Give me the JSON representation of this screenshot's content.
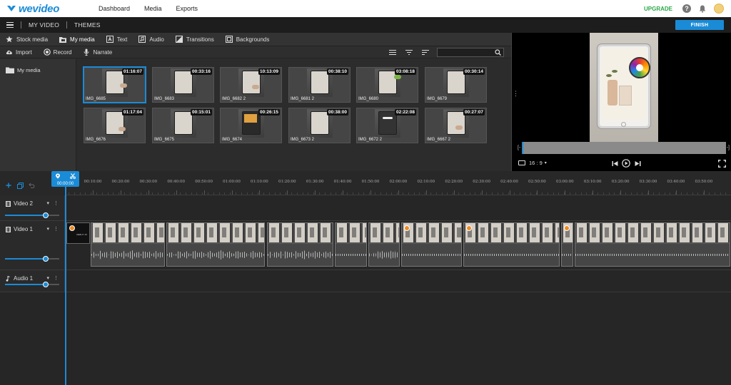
{
  "app": {
    "logo": "wevideo",
    "nav": [
      "Dashboard",
      "Media",
      "Exports"
    ],
    "upgrade": "UPGRADE",
    "help_glyph": "?",
    "colors": {
      "accent": "#1a8bd6",
      "upgrade": "#2aa847",
      "badge": "#f08a24"
    }
  },
  "project": {
    "title": "MY VIDEO",
    "themes": "THEMES",
    "finish": "FINISH"
  },
  "media": {
    "tabs": [
      {
        "label": "Stock media",
        "icon": "star-icon"
      },
      {
        "label": "My media",
        "icon": "folder-camera-icon",
        "active": true
      },
      {
        "label": "Text",
        "icon": "text-icon"
      },
      {
        "label": "Audio",
        "icon": "music-icon"
      },
      {
        "label": "Transitions",
        "icon": "transitions-icon"
      },
      {
        "label": "Backgrounds",
        "icon": "image-icon"
      }
    ],
    "tools": [
      {
        "label": "Import",
        "icon": "cloud-upload-icon"
      },
      {
        "label": "Record",
        "icon": "record-icon"
      },
      {
        "label": "Narrate",
        "icon": "microphone-icon"
      }
    ],
    "search": {
      "placeholder": "",
      "value": ""
    },
    "folder": "My media",
    "items": [
      {
        "name": "IMG_6685",
        "duration": "01:16:07",
        "selected": true
      },
      {
        "name": "IMG_6683",
        "duration": "00:33:16"
      },
      {
        "name": "IMG_6682 2",
        "duration": "10:13:09"
      },
      {
        "name": "IMG_6681 2",
        "duration": "00:38:10"
      },
      {
        "name": "IMG_6680",
        "duration": "03:08:18"
      },
      {
        "name": "IMG_6679",
        "duration": "00:30:14"
      },
      {
        "name": "IMG_6676",
        "duration": "01:17:04"
      },
      {
        "name": "IMG_6675",
        "duration": "00:15:01"
      },
      {
        "name": "IMG_6674",
        "duration": "00:26:15"
      },
      {
        "name": "IMG_6673 2",
        "duration": "00:38:00"
      },
      {
        "name": "IMG_6672 2",
        "duration": "02:22:08"
      },
      {
        "name": "IMG_6667 2",
        "duration": "00:27:07"
      }
    ]
  },
  "preview": {
    "aspect_ratio": "16 : 9",
    "bracket_in": "[-",
    "bracket_out": "-]"
  },
  "timeline": {
    "playhead_time": "00:00:00",
    "ticks": [
      "00:10:00",
      "00:20:00",
      "00:30:00",
      "00:40:00",
      "00:50:00",
      "01:00:00",
      "01:10:00",
      "01:20:00",
      "01:30:00",
      "01:40:00",
      "01:50:00",
      "02:00:00",
      "02:10:00",
      "02:20:00",
      "02:30:00",
      "02:40:00",
      "02:50:00",
      "03:00:00",
      "03:10:00",
      "03:20:00",
      "03:30:00",
      "03:40:00",
      "03:50:00"
    ],
    "tracks": [
      {
        "name": "Video 2",
        "volume": 0.75
      },
      {
        "name": "Video 1",
        "volume": 0.75
      },
      {
        "name": "Audio 1",
        "volume": 0.75
      }
    ],
    "title_clip_text": "DEBUT JO",
    "clip_menu_glyph": "▾",
    "clip_more_glyph": "⋮"
  }
}
